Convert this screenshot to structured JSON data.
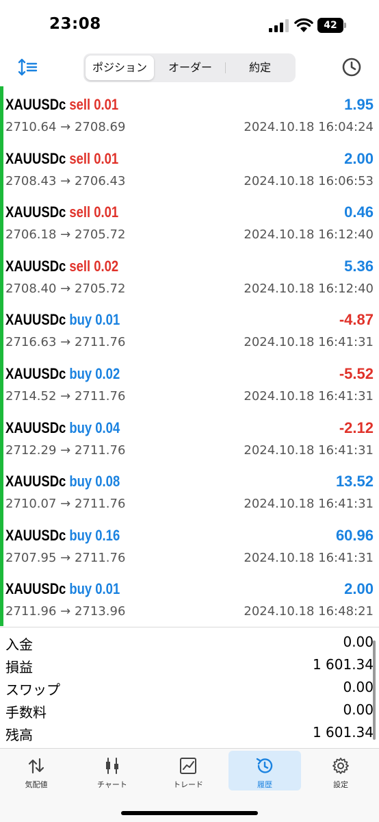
{
  "status_bar": {
    "time": "23:08",
    "battery": "42"
  },
  "segments": {
    "positions": "ポジション",
    "orders": "オーダー",
    "deals": "約定"
  },
  "positions": [
    {
      "symbol": "XAUUSDc",
      "type": "sell",
      "volume": "0.01",
      "profit": "1.95",
      "prices": "2710.64 → 2708.69",
      "time": "2024.10.18 16:04:24"
    },
    {
      "symbol": "XAUUSDc",
      "type": "sell",
      "volume": "0.01",
      "profit": "2.00",
      "prices": "2708.43 → 2706.43",
      "time": "2024.10.18 16:06:53"
    },
    {
      "symbol": "XAUUSDc",
      "type": "sell",
      "volume": "0.01",
      "profit": "0.46",
      "prices": "2706.18 → 2705.72",
      "time": "2024.10.18 16:12:40"
    },
    {
      "symbol": "XAUUSDc",
      "type": "sell",
      "volume": "0.02",
      "profit": "5.36",
      "prices": "2708.40 → 2705.72",
      "time": "2024.10.18 16:12:40"
    },
    {
      "symbol": "XAUUSDc",
      "type": "buy",
      "volume": "0.01",
      "profit": "-4.87",
      "prices": "2716.63 → 2711.76",
      "time": "2024.10.18 16:41:31"
    },
    {
      "symbol": "XAUUSDc",
      "type": "buy",
      "volume": "0.02",
      "profit": "-5.52",
      "prices": "2714.52 → 2711.76",
      "time": "2024.10.18 16:41:31"
    },
    {
      "symbol": "XAUUSDc",
      "type": "buy",
      "volume": "0.04",
      "profit": "-2.12",
      "prices": "2712.29 → 2711.76",
      "time": "2024.10.18 16:41:31"
    },
    {
      "symbol": "XAUUSDc",
      "type": "buy",
      "volume": "0.08",
      "profit": "13.52",
      "prices": "2710.07 → 2711.76",
      "time": "2024.10.18 16:41:31"
    },
    {
      "symbol": "XAUUSDc",
      "type": "buy",
      "volume": "0.16",
      "profit": "60.96",
      "prices": "2707.95 → 2711.76",
      "time": "2024.10.18 16:41:31"
    },
    {
      "symbol": "XAUUSDc",
      "type": "buy",
      "volume": "0.01",
      "profit": "2.00",
      "prices": "2711.96 → 2713.96",
      "time": "2024.10.18 16:48:21"
    }
  ],
  "summary": {
    "deposit_label": "入金",
    "deposit_value": "0.00",
    "pl_label": "損益",
    "pl_value": "1 601.34",
    "swap_label": "スワップ",
    "swap_value": "0.00",
    "commission_label": "手数料",
    "commission_value": "0.00",
    "balance_label": "残高",
    "balance_value": "1 601.34"
  },
  "tabs": {
    "quotes": "気配値",
    "chart": "チャート",
    "trade": "トレード",
    "history": "履歴",
    "settings": "設定"
  },
  "colors": {
    "sell": "#e0322a",
    "buy": "#1a82e0",
    "accent": "#1a82e0",
    "indicator": "#1cb93a"
  },
  "icons": {
    "nav_left": "sort-icon",
    "nav_right": "clock-icon",
    "tab_quotes": "arrows-up-down-icon",
    "tab_chart": "candlestick-icon",
    "tab_trade": "line-chart-icon",
    "tab_history": "history-icon",
    "tab_settings": "gear-icon"
  }
}
